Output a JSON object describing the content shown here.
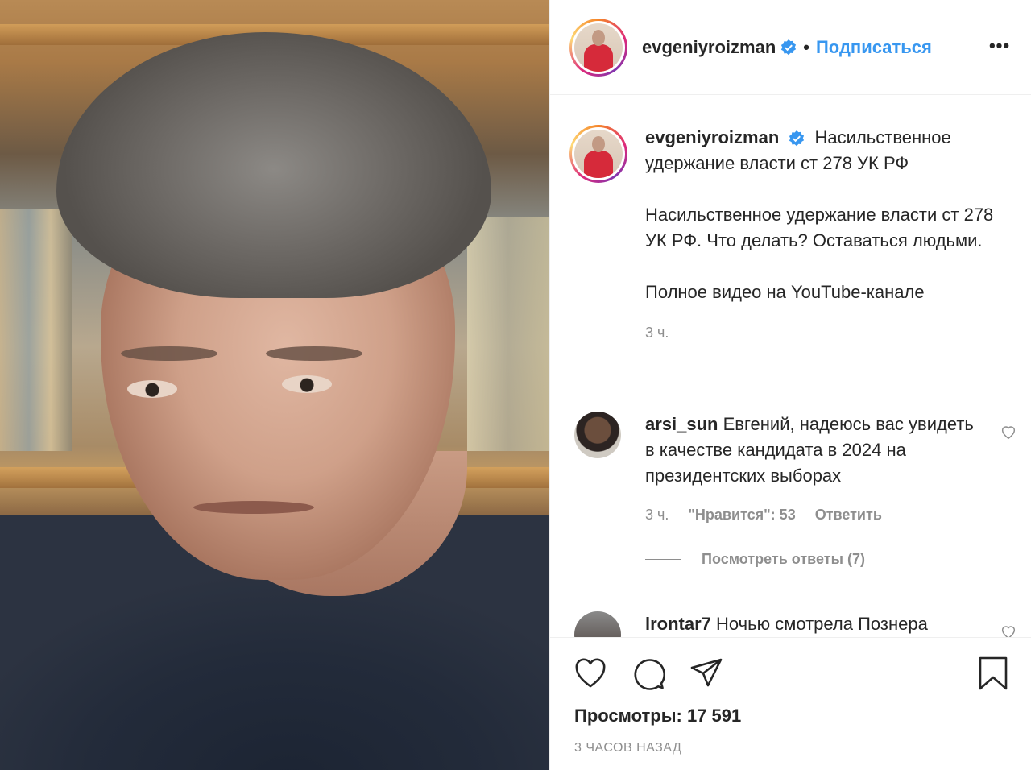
{
  "post": {
    "media_alt": "",
    "author": {
      "username": "evgeniyroizman",
      "verified": true,
      "follow_label": "Подписаться",
      "separator": "•",
      "more_label": "•••"
    },
    "caption": {
      "username": "evgeniyroizman",
      "title": "Насильственное удержание власти ст 278 УК РФ",
      "body": "Насильственное удержание власти ст 278 УК РФ. Что делать? Оставаться людьми.",
      "link_line": "Полное видео на YouTube-канале",
      "time": "3 ч."
    },
    "comments": [
      {
        "username": "arsi_sun",
        "text": "Евгений, надеюсь вас увидеть в качестве кандидата в 2024 на президентских выборах",
        "time": "3 ч.",
        "likes": "\"Нравится\": 53",
        "reply_label": "Ответить",
        "view_replies": "Посмотреть ответы (7)"
      },
      {
        "username": "lrontar7",
        "text": "Ночью смотрела Познера"
      }
    ],
    "footer": {
      "views": "Просмотры: 17 591",
      "posted": "3 ЧАСОВ НАЗАД"
    }
  },
  "colors": {
    "link_blue": "#3897f0",
    "muted": "#8e8e8e",
    "text": "#262626",
    "verified_blue": "#3897f0"
  }
}
